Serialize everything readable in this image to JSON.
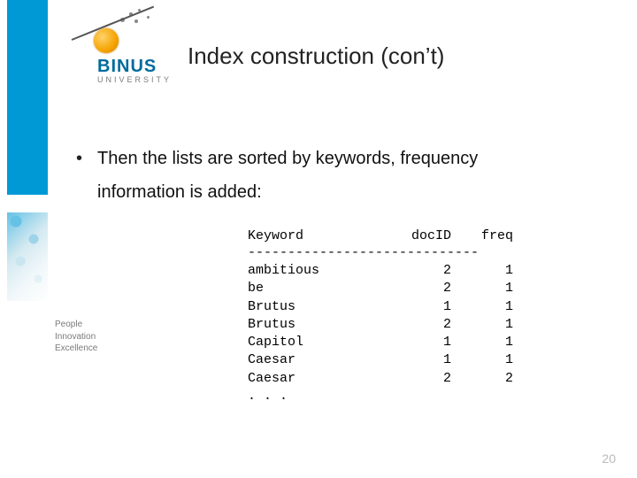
{
  "logo": {
    "brand": "BINUS",
    "sub": "UNIVERSITY"
  },
  "tagline": {
    "line1": "People",
    "line2": "Innovation",
    "line3": "Excellence"
  },
  "title": "Index construction (con’t)",
  "bullet": {
    "line1": "Then the lists are sorted by keywords, frequency",
    "line2": "information is added:"
  },
  "table": {
    "headers": {
      "c1": "Keyword",
      "c2": "docID",
      "c3": "freq"
    },
    "separator": "-----------------------------",
    "rows": [
      {
        "c1": "ambitious",
        "c2": "2",
        "c3": "1"
      },
      {
        "c1": "be",
        "c2": "2",
        "c3": "1"
      },
      {
        "c1": "Brutus",
        "c2": "1",
        "c3": "1"
      },
      {
        "c1": "Brutus",
        "c2": "2",
        "c3": "1"
      },
      {
        "c1": "Capitol",
        "c2": "1",
        "c3": "1"
      },
      {
        "c1": "Caesar",
        "c2": "1",
        "c3": "1"
      },
      {
        "c1": "Caesar",
        "c2": "2",
        "c3": "2"
      }
    ],
    "ellipsis": ". . ."
  },
  "page_number": "20",
  "chart_data": {
    "type": "table",
    "title": "Sorted postings with frequency",
    "columns": [
      "Keyword",
      "docID",
      "freq"
    ],
    "rows": [
      [
        "ambitious",
        2,
        1
      ],
      [
        "be",
        2,
        1
      ],
      [
        "Brutus",
        1,
        1
      ],
      [
        "Brutus",
        2,
        1
      ],
      [
        "Capitol",
        1,
        1
      ],
      [
        "Caesar",
        1,
        1
      ],
      [
        "Caesar",
        2,
        2
      ]
    ]
  }
}
